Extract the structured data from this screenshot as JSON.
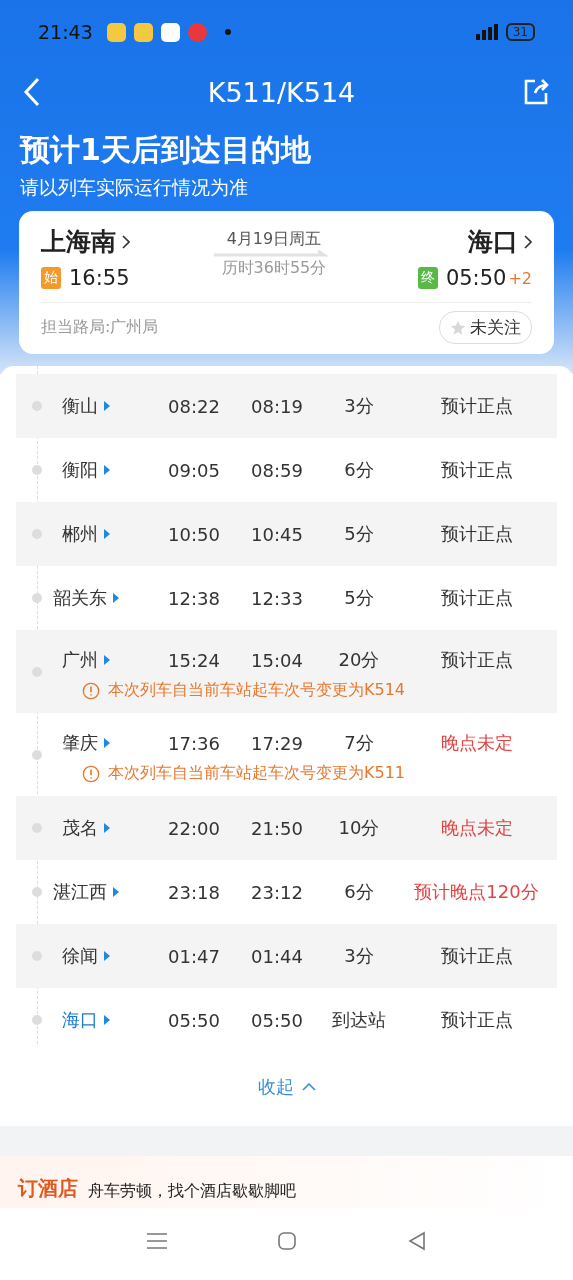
{
  "status_bar": {
    "time": "21:43",
    "battery": "31"
  },
  "header": {
    "title": "K511/K514"
  },
  "headline": {
    "title": "预计1天后到达目的地",
    "subtitle": "请以列车实际运行情况为准"
  },
  "trip": {
    "from": "上海南",
    "from_badge": "始",
    "depart": "16:55",
    "date": "4月19日周五",
    "duration": "历时36时55分",
    "to": "海口",
    "to_badge": "终",
    "arrive": "05:50",
    "day_offset": "+2",
    "bureau": "担当路局:广州局",
    "follow": {
      "label": "未关注",
      "on": false
    }
  },
  "stops": [
    {
      "station": "衡山",
      "arrive": "08:22",
      "depart": "08:19",
      "stay": "3分",
      "status": "预计正点",
      "late": false,
      "current": false
    },
    {
      "station": "衡阳",
      "arrive": "09:05",
      "depart": "08:59",
      "stay": "6分",
      "status": "预计正点",
      "late": false,
      "current": false
    },
    {
      "station": "郴州",
      "arrive": "10:50",
      "depart": "10:45",
      "stay": "5分",
      "status": "预计正点",
      "late": false,
      "current": false
    },
    {
      "station": "韶关东",
      "arrive": "12:38",
      "depart": "12:33",
      "stay": "5分",
      "status": "预计正点",
      "late": false,
      "current": false
    },
    {
      "station": "广州",
      "arrive": "15:24",
      "depart": "15:04",
      "stay": "20分",
      "status": "预计正点",
      "late": false,
      "current": false,
      "notice": "本次列车自当前车站起车次号变更为K514"
    },
    {
      "station": "肇庆",
      "arrive": "17:36",
      "depart": "17:29",
      "stay": "7分",
      "status": "晚点未定",
      "late": true,
      "current": false,
      "notice": "本次列车自当前车站起车次号变更为K511"
    },
    {
      "station": "茂名",
      "arrive": "22:00",
      "depart": "21:50",
      "stay": "10分",
      "status": "晚点未定",
      "late": true,
      "current": false
    },
    {
      "station": "湛江西",
      "arrive": "23:18",
      "depart": "23:12",
      "stay": "6分",
      "status": "预计晚点120分",
      "late": true,
      "current": false
    },
    {
      "station": "徐闻",
      "arrive": "01:47",
      "depart": "01:44",
      "stay": "3分",
      "status": "预计正点",
      "late": false,
      "current": false
    },
    {
      "station": "海口",
      "arrive": "05:50",
      "depart": "05:50",
      "stay": "到达站",
      "status": "预计正点",
      "late": false,
      "current": true
    }
  ],
  "collapse": {
    "label": "收起"
  },
  "hotel": {
    "title": "订酒店",
    "slogan": "舟车劳顿，找个酒店歇歇脚吧"
  }
}
